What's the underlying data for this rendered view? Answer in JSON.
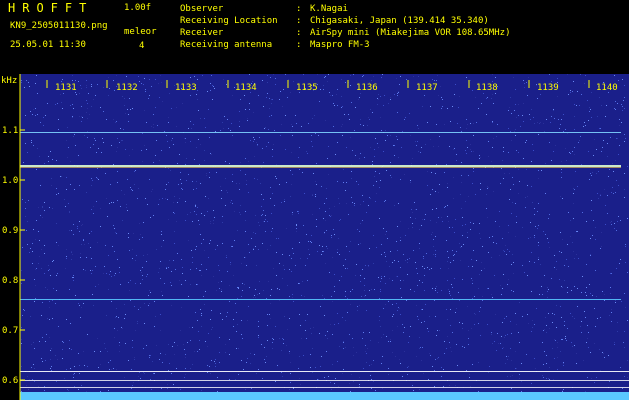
{
  "header": {
    "app_title": "HROFFT",
    "version": "1.00f",
    "filename": "KN9_2505011130.png",
    "mode": "meleor",
    "datetime": "25.05.01 11:30",
    "level": "4"
  },
  "station_info": [
    {
      "key": "Observer",
      "value": "K.Nagai"
    },
    {
      "key": "Receiving Location",
      "value": "Chigasaki, Japan (139.414 35.340)"
    },
    {
      "key": "Receiver",
      "value": "AirSpy mini (Miakejima VOR 108.65MHz)"
    },
    {
      "key": "Receiving antenna",
      "value": "Maspro FM-3"
    }
  ],
  "spectrogram": {
    "y_unit": "kHz",
    "y_ticks": [
      "1.1",
      "1.0",
      "0.9",
      "0.8",
      "0.7",
      "0.6"
    ],
    "x_ticks": [
      "1131",
      "1132",
      "1133",
      "1134",
      "1135",
      "1136",
      "1137",
      "1138",
      "1139",
      "1140"
    ],
    "colors": {
      "text": "#ffff00",
      "background": "#1a1f8a",
      "bright_trace": "#ffffff",
      "bottom_band": "#5ac8ff"
    }
  }
}
